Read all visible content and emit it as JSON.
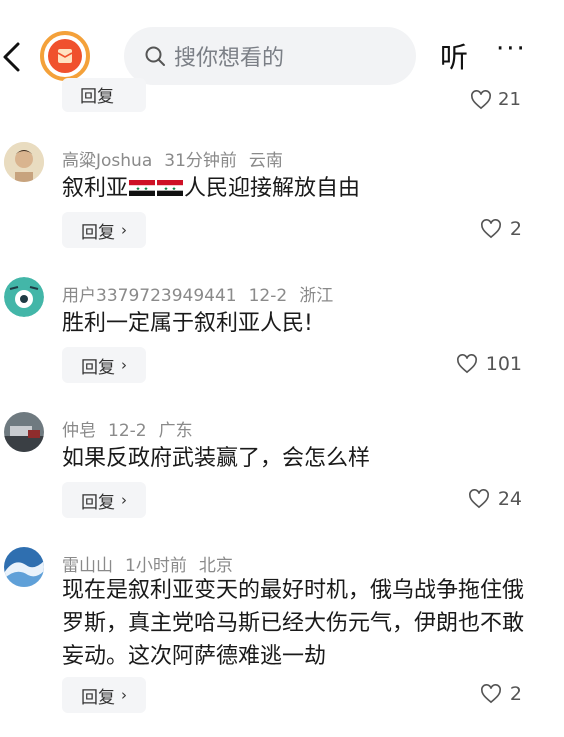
{
  "header": {
    "search_placeholder": "搜你想看的",
    "listen_label": "听",
    "more_label": "···"
  },
  "previous_comment": {
    "reply_label": "回复",
    "likes": "21"
  },
  "comments": [
    {
      "user": "高粱Joshua",
      "time": "31分钟前",
      "location": "云南",
      "text_before": "叙利亚",
      "text_after": "人民迎接解放自由",
      "reply_label": "回复",
      "likes": "2"
    },
    {
      "user": "用户3379723949441",
      "time": "12-2",
      "location": "浙江",
      "text": "胜利一定属于叙利亚人民!",
      "reply_label": "回复",
      "likes": "101"
    },
    {
      "user": "仲皂",
      "time": "12-2",
      "location": "广东",
      "text": "如果反政府武装赢了，会怎么样",
      "reply_label": "回复",
      "likes": "24"
    },
    {
      "user": "雷山山",
      "time": "1小时前",
      "location": "北京",
      "text": "现在是叙利亚变天的最好时机，俄乌战争拖住俄罗斯，真主党哈马斯已经大伤元气，伊朗也不敢妄动。这次阿萨德难逃一劫",
      "reply_label": "回复",
      "likes": "2"
    }
  ]
}
